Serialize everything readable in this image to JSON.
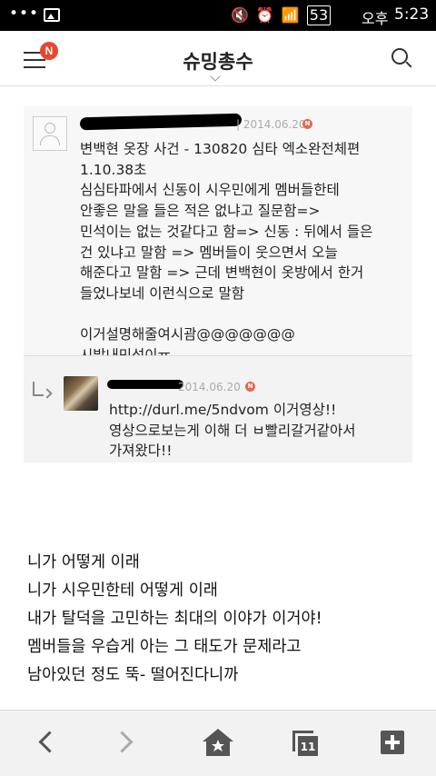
{
  "status_bar": {
    "notification_dots": "•••",
    "battery": "53",
    "ampm": "오후",
    "time": "5:23"
  },
  "app_bar": {
    "title": "슈밍총수",
    "menu_badge": "N"
  },
  "screenshot": {
    "post": {
      "date": "| 2014.06.20",
      "badge": "N",
      "lines": [
        "변백현 옷장 사건 - 130820 심타 엑소완전체편",
        "1.10.38초",
        "심심타파에서 신동이 시우민에게 멤버들한테",
        "안좋은 말을 들은 적은 없냐고 질문함=>",
        "민석이는 없는 것같다고 함=> 신동 : 뒤에서 들은",
        "건 있냐고 말함 => 멤버들이 웃으면서 오늘",
        "해준다고 말함 => 근데 변백현이 옷방에서 한거",
        "들었나보네 이런식으로 말함",
        "",
        "이거설명해줄여시괌@@@@@@@",
        "시발내민석이ㅠ"
      ]
    },
    "reply": {
      "date": "2014.06.20",
      "badge": "N",
      "lines": [
        "http://durl.me/5ndvom 이거영상!!",
        "영상으로보는게 이해 더 ㅂ빨리갈거같아서",
        "가져왔다!!"
      ]
    }
  },
  "article": {
    "lines": [
      "니가 어떻게 이래",
      "니가 시우민한테 어떻게 이래",
      "내가 탈덕을 고민하는 최대의 이야가 이거야!",
      "멤버들을 우습게 아는 그 태도가 문제라고",
      "남아있던 정도 뚝- 떨어진다니까"
    ]
  },
  "bottom_nav": {
    "tabs_count": "11"
  }
}
